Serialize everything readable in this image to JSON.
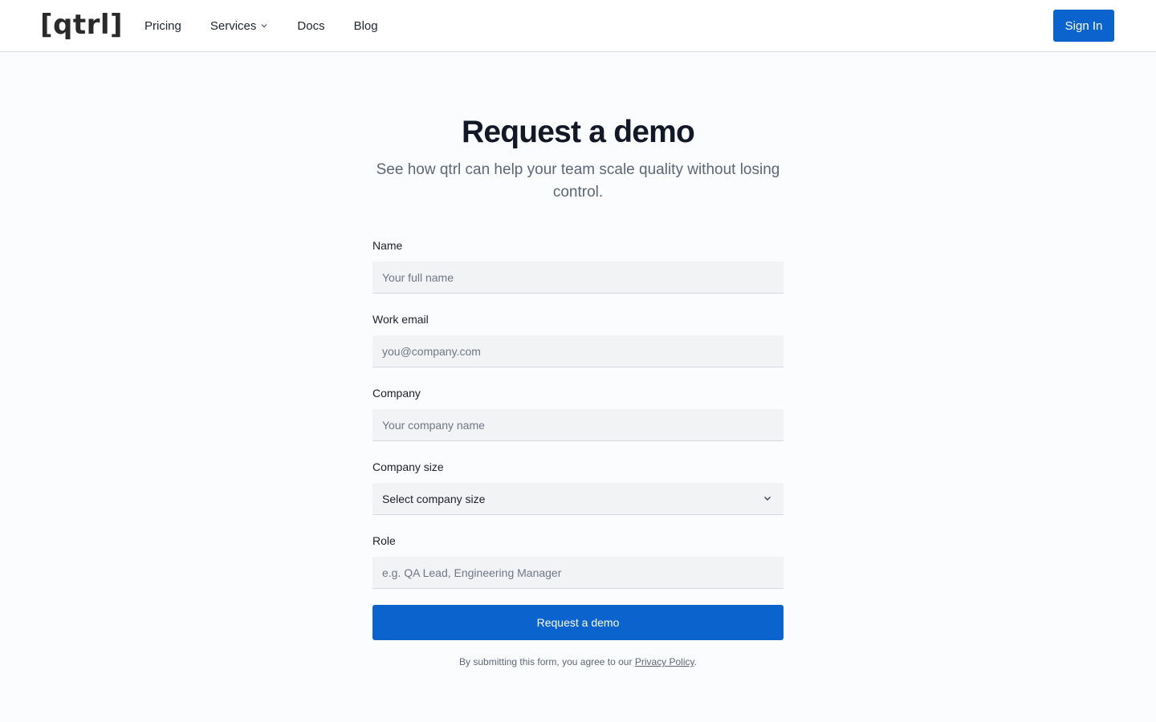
{
  "header": {
    "logo_text": "[qtrl]",
    "nav": [
      {
        "label": "Pricing",
        "icon": ""
      },
      {
        "label": "Services",
        "icon": "chevron-down-icon"
      },
      {
        "label": "Docs",
        "icon": ""
      },
      {
        "label": "Blog",
        "icon": ""
      }
    ],
    "signin_label": "Sign In"
  },
  "hero": {
    "title": "Request a demo",
    "subtitle": "See how qtrl can help your team scale quality without losing control."
  },
  "form": {
    "name": {
      "label": "Name",
      "placeholder": "Your full name"
    },
    "email": {
      "label": "Work email",
      "placeholder": "you@company.com"
    },
    "company": {
      "label": "Company",
      "placeholder": "Your company name"
    },
    "company_size": {
      "label": "Company size",
      "value": "Select company size",
      "icon": "chevron-down-icon"
    },
    "role": {
      "label": "Role",
      "placeholder": "e.g. QA Lead, Engineering Manager"
    },
    "submit_label": "Request a demo",
    "legal_prefix": "By submitting this form, you agree to our ",
    "legal_link": "Privacy Policy",
    "legal_suffix": "."
  },
  "colors": {
    "accent": "#0b63ce",
    "background": "#fbfcfd",
    "input_bg": "#f1f3f5"
  }
}
